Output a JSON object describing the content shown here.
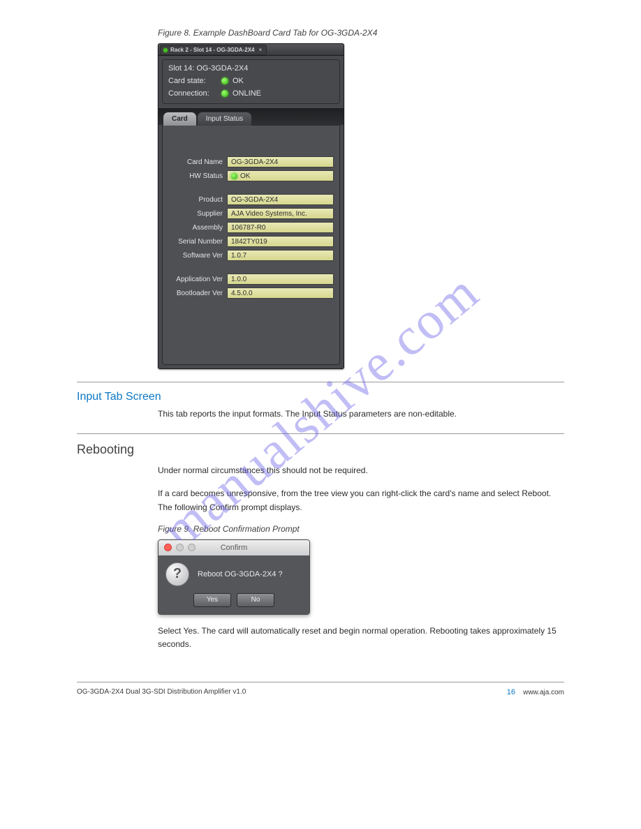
{
  "figure_caption": "Figure 8. Example DashBoard Card Tab for OG-3GDA-2X4",
  "card_panel": {
    "window_tab": {
      "status_dot": "green",
      "title": "Rack 2 - Slot 14 - OG-3GDA-2X4"
    },
    "header": {
      "title": "Slot 14: OG-3GDA-2X4",
      "card_state_label": "Card state:",
      "card_state_value": "OK",
      "connection_label": "Connection:",
      "connection_value": "ONLINE"
    },
    "tabs": [
      {
        "label": "Card",
        "active": true
      },
      {
        "label": "Input Status",
        "active": false
      }
    ],
    "fields_group1": [
      {
        "label": "Card Name",
        "value": "OG-3GDA-2X4"
      },
      {
        "label": "HW Status",
        "value": "OK",
        "has_dot": true
      }
    ],
    "fields_group2": [
      {
        "label": "Product",
        "value": "OG-3GDA-2X4"
      },
      {
        "label": "Supplier",
        "value": "AJA Video Systems, Inc."
      },
      {
        "label": "Assembly",
        "value": "106787-R0"
      },
      {
        "label": "Serial Number",
        "value": "1842TY019"
      },
      {
        "label": "Software Ver",
        "value": "1.0.7"
      }
    ],
    "fields_group3": [
      {
        "label": "Application Ver",
        "value": "1.0.0"
      },
      {
        "label": "Bootloader Ver",
        "value": "4.5.0.0"
      }
    ]
  },
  "section_input": {
    "heading": "Input Tab Screen",
    "body": "This tab reports the input formats. The Input Status parameters are non-editable."
  },
  "section_reboot": {
    "heading": "Rebooting",
    "body1": "Under normal circumstances this should not be required.",
    "body2": "If a card becomes unresponsive, from the tree view you can right-click the card's name and select Reboot. The following Confirm prompt displays.",
    "figure_caption": "Figure 9. Reboot Confirmation Prompt"
  },
  "confirm_dialog": {
    "title": "Confirm",
    "message": "Reboot OG-3GDA-2X4 ?",
    "yes_label": "Yes",
    "no_label": "No"
  },
  "section_reboot_after": "Select Yes. The card will automatically reset and begin normal operation. Rebooting takes approximately 15 seconds.",
  "footer": {
    "left": "OG-3GDA-2X4 Dual 3G-SDI Distribution Amplifier v1.0",
    "right": "16",
    "site": "www.aja.com"
  },
  "watermark": "manualshive.com"
}
